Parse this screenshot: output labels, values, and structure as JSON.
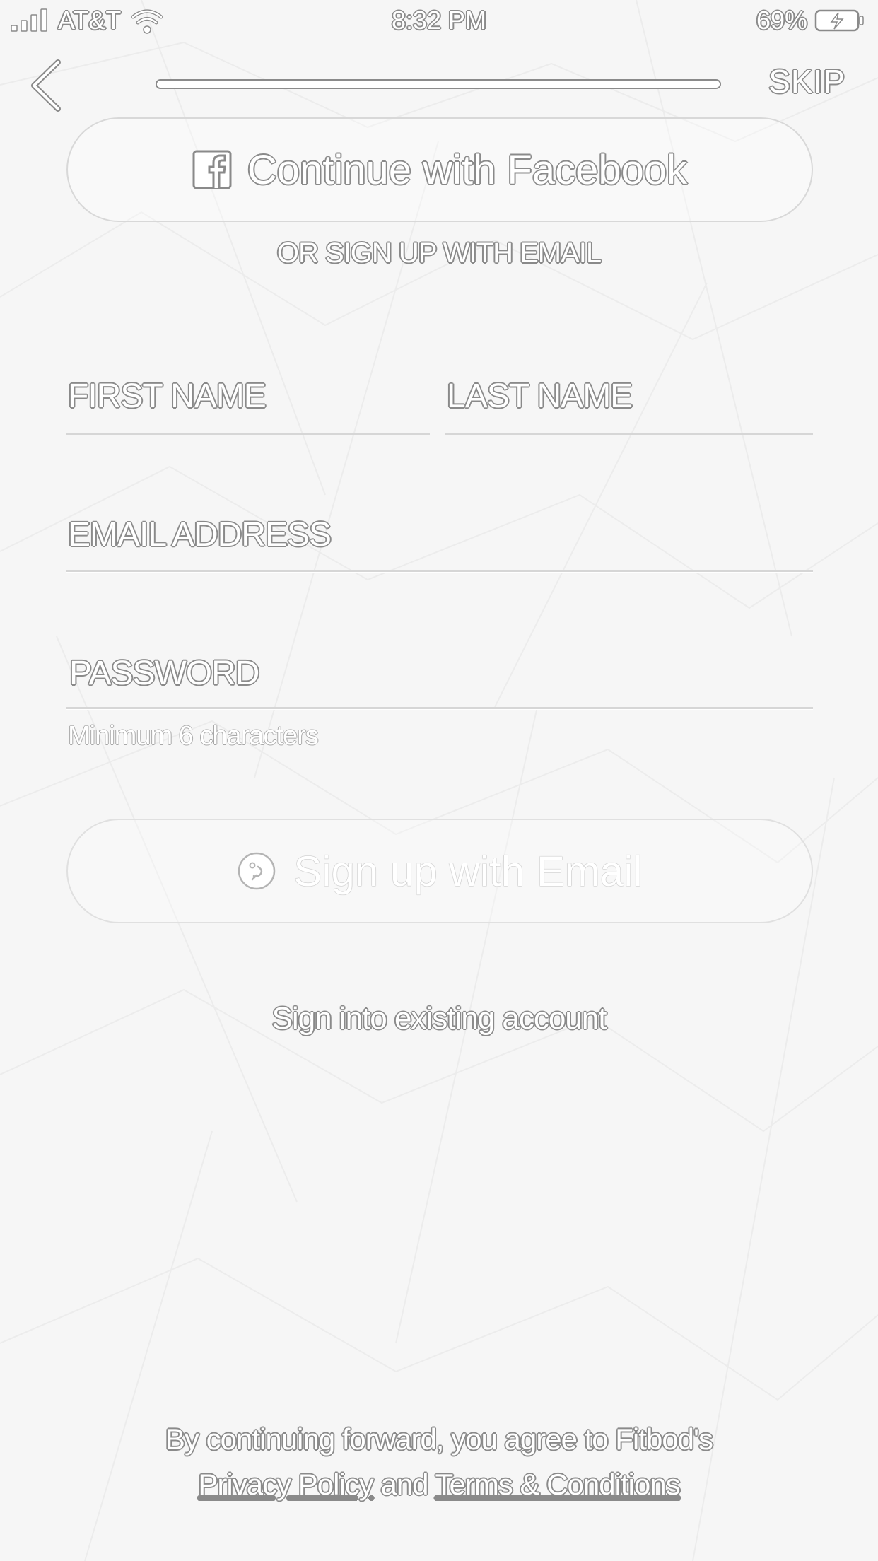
{
  "status_bar": {
    "carrier": "AT&T",
    "time": "8:32 PM",
    "battery": "69%"
  },
  "nav": {
    "back_icon": "chevron-left-icon",
    "progress": 1.0,
    "skip_label": "SKIP"
  },
  "facebook_button": {
    "icon": "facebook-icon",
    "label": "Continue with Facebook"
  },
  "divider_label": "OR SIGN UP WITH EMAIL",
  "form": {
    "first_name": {
      "placeholder": "FIRST NAME",
      "value": ""
    },
    "last_name": {
      "placeholder": "LAST NAME",
      "value": ""
    },
    "email": {
      "placeholder": "EMAIL ADDRESS",
      "value": ""
    },
    "password": {
      "placeholder": "PASSWORD",
      "value": ""
    },
    "password_hint": "Minimum 6 characters"
  },
  "email_button": {
    "icon": "fitbod-logo-icon",
    "label": "Sign up with Email"
  },
  "signin_link": "Sign into existing account",
  "legal": {
    "line1": "By continuing forward, you agree to Fitbod's",
    "privacy": "Privacy Policy",
    "and": "and",
    "terms": "Terms & Conditions"
  },
  "colors": {
    "background": "#f6f6f6",
    "outline": "#8a8a8a",
    "border": "#d8d8d8"
  }
}
